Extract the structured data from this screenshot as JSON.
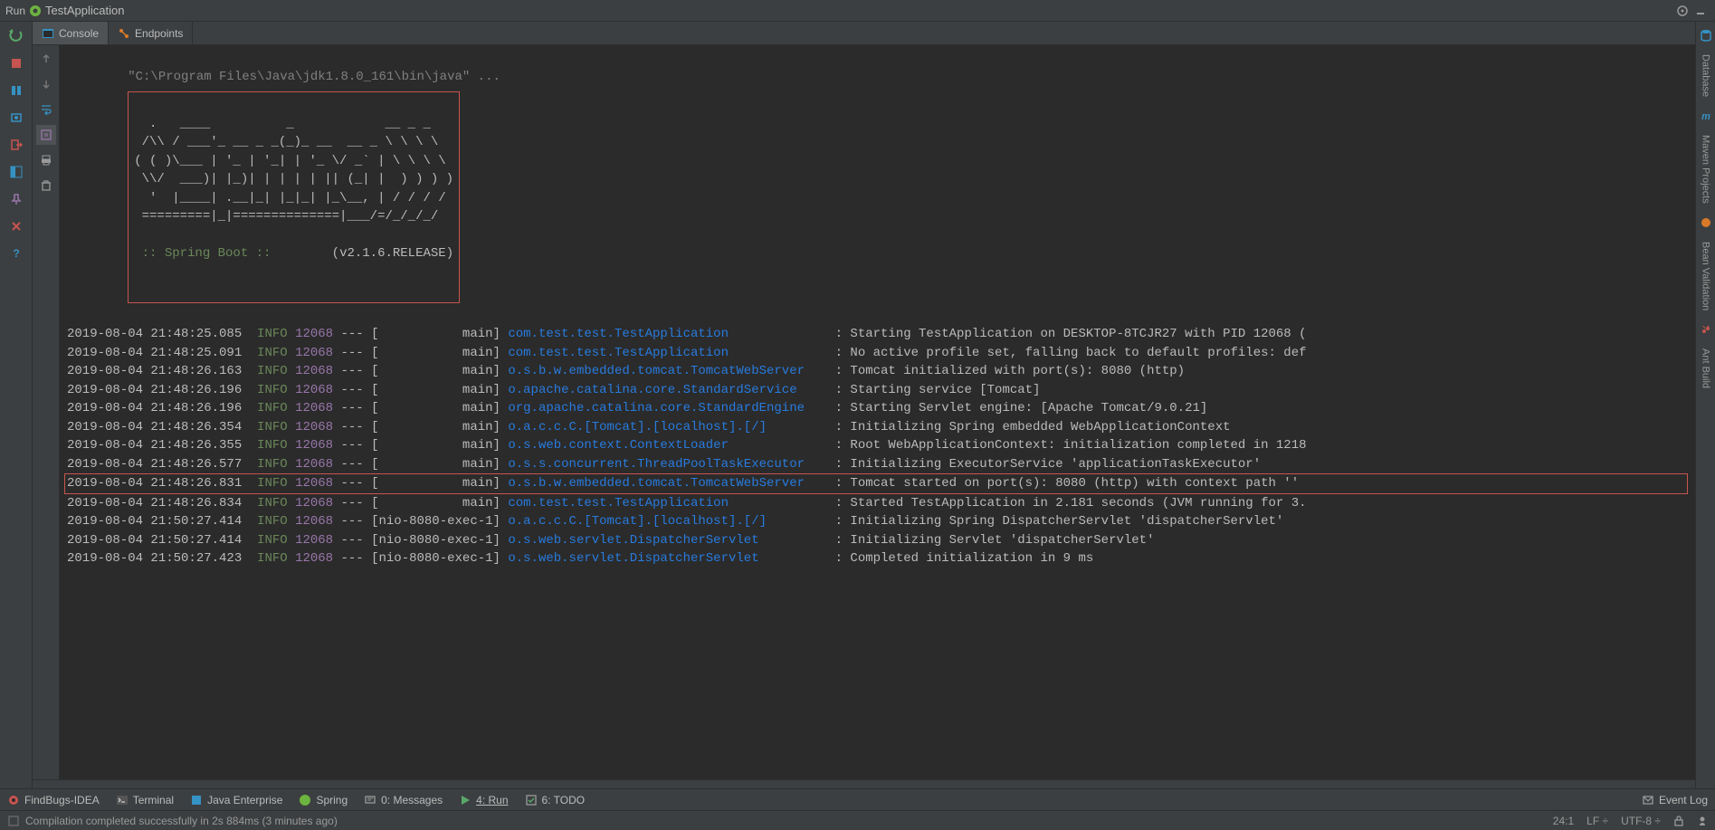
{
  "topbar": {
    "run_label": "Run",
    "app_name": "TestApplication"
  },
  "tabs": {
    "console": "Console",
    "endpoints": "Endpoints"
  },
  "console": {
    "cmdline": "\"C:\\Program Files\\Java\\jdk1.8.0_161\\bin\\java\" ...",
    "banner_ascii": "  .   ____          _            __ _ _\n /\\\\ / ___'_ __ _ _(_)_ __  __ _ \\ \\ \\ \\\n( ( )\\___ | '_ | '_| | '_ \\/ _` | \\ \\ \\ \\\n \\\\/  ___)| |_)| | | | | || (_| |  ) ) ) )\n  '  |____| .__|_| |_|_| |_\\__, | / / / /\n =========|_|==============|___/=/_/_/_/",
    "banner_label": " :: Spring Boot :: ",
    "banner_version": "(v2.1.6.RELEASE)",
    "log_rows": [
      {
        "ts": "2019-08-04 21:48:25.085",
        "lv": "INFO",
        "pid": "12068",
        "thr": "           main",
        "logger": "com.test.test.TestApplication             ",
        "msg": "Starting TestApplication on DESKTOP-8TCJR27 with PID 12068 (",
        "hl": false
      },
      {
        "ts": "2019-08-04 21:48:25.091",
        "lv": "INFO",
        "pid": "12068",
        "thr": "           main",
        "logger": "com.test.test.TestApplication             ",
        "msg": "No active profile set, falling back to default profiles: def",
        "hl": false
      },
      {
        "ts": "2019-08-04 21:48:26.163",
        "lv": "INFO",
        "pid": "12068",
        "thr": "           main",
        "logger": "o.s.b.w.embedded.tomcat.TomcatWebServer   ",
        "msg": "Tomcat initialized with port(s): 8080 (http)",
        "hl": false
      },
      {
        "ts": "2019-08-04 21:48:26.196",
        "lv": "INFO",
        "pid": "12068",
        "thr": "           main",
        "logger": "o.apache.catalina.core.StandardService    ",
        "msg": "Starting service [Tomcat]",
        "hl": false
      },
      {
        "ts": "2019-08-04 21:48:26.196",
        "lv": "INFO",
        "pid": "12068",
        "thr": "           main",
        "logger": "org.apache.catalina.core.StandardEngine   ",
        "msg": "Starting Servlet engine: [Apache Tomcat/9.0.21]",
        "hl": false
      },
      {
        "ts": "2019-08-04 21:48:26.354",
        "lv": "INFO",
        "pid": "12068",
        "thr": "           main",
        "logger": "o.a.c.c.C.[Tomcat].[localhost].[/]        ",
        "msg": "Initializing Spring embedded WebApplicationContext",
        "hl": false
      },
      {
        "ts": "2019-08-04 21:48:26.355",
        "lv": "INFO",
        "pid": "12068",
        "thr": "           main",
        "logger": "o.s.web.context.ContextLoader             ",
        "msg": "Root WebApplicationContext: initialization completed in 1218",
        "hl": false
      },
      {
        "ts": "2019-08-04 21:48:26.577",
        "lv": "INFO",
        "pid": "12068",
        "thr": "           main",
        "logger": "o.s.s.concurrent.ThreadPoolTaskExecutor   ",
        "msg": "Initializing ExecutorService 'applicationTaskExecutor'",
        "hl": false
      },
      {
        "ts": "2019-08-04 21:48:26.831",
        "lv": "INFO",
        "pid": "12068",
        "thr": "           main",
        "logger": "o.s.b.w.embedded.tomcat.TomcatWebServer   ",
        "msg": "Tomcat started on port(s): 8080 (http) with context path ''",
        "hl": true
      },
      {
        "ts": "2019-08-04 21:48:26.834",
        "lv": "INFO",
        "pid": "12068",
        "thr": "           main",
        "logger": "com.test.test.TestApplication             ",
        "msg": "Started TestApplication in 2.181 seconds (JVM running for 3.",
        "hl": false
      },
      {
        "ts": "2019-08-04 21:50:27.414",
        "lv": "INFO",
        "pid": "12068",
        "thr": "nio-8080-exec-1",
        "logger": "o.a.c.c.C.[Tomcat].[localhost].[/]        ",
        "msg": "Initializing Spring DispatcherServlet 'dispatcherServlet'",
        "hl": false
      },
      {
        "ts": "2019-08-04 21:50:27.414",
        "lv": "INFO",
        "pid": "12068",
        "thr": "nio-8080-exec-1",
        "logger": "o.s.web.servlet.DispatcherServlet         ",
        "msg": "Initializing Servlet 'dispatcherServlet'",
        "hl": false
      },
      {
        "ts": "2019-08-04 21:50:27.423",
        "lv": "INFO",
        "pid": "12068",
        "thr": "nio-8080-exec-1",
        "logger": "o.s.web.servlet.DispatcherServlet         ",
        "msg": "Completed initialization in 9 ms",
        "hl": false
      }
    ]
  },
  "right_panel": {
    "items": [
      "Database",
      "Maven Projects",
      "Bean Validation",
      "Ant Build"
    ]
  },
  "bottom_tools": {
    "findbugs": "FindBugs-IDEA",
    "terminal": "Terminal",
    "javaee": "Java Enterprise",
    "spring": "Spring",
    "messages": "0: Messages",
    "run": "4: Run",
    "todo": "6: TODO",
    "eventlog": "Event Log"
  },
  "statusbar": {
    "message": "Compilation completed successfully in 2s 884ms (3 minutes ago)",
    "pos": "24:1",
    "lineend": "LF",
    "encoding": "UTF-8"
  }
}
